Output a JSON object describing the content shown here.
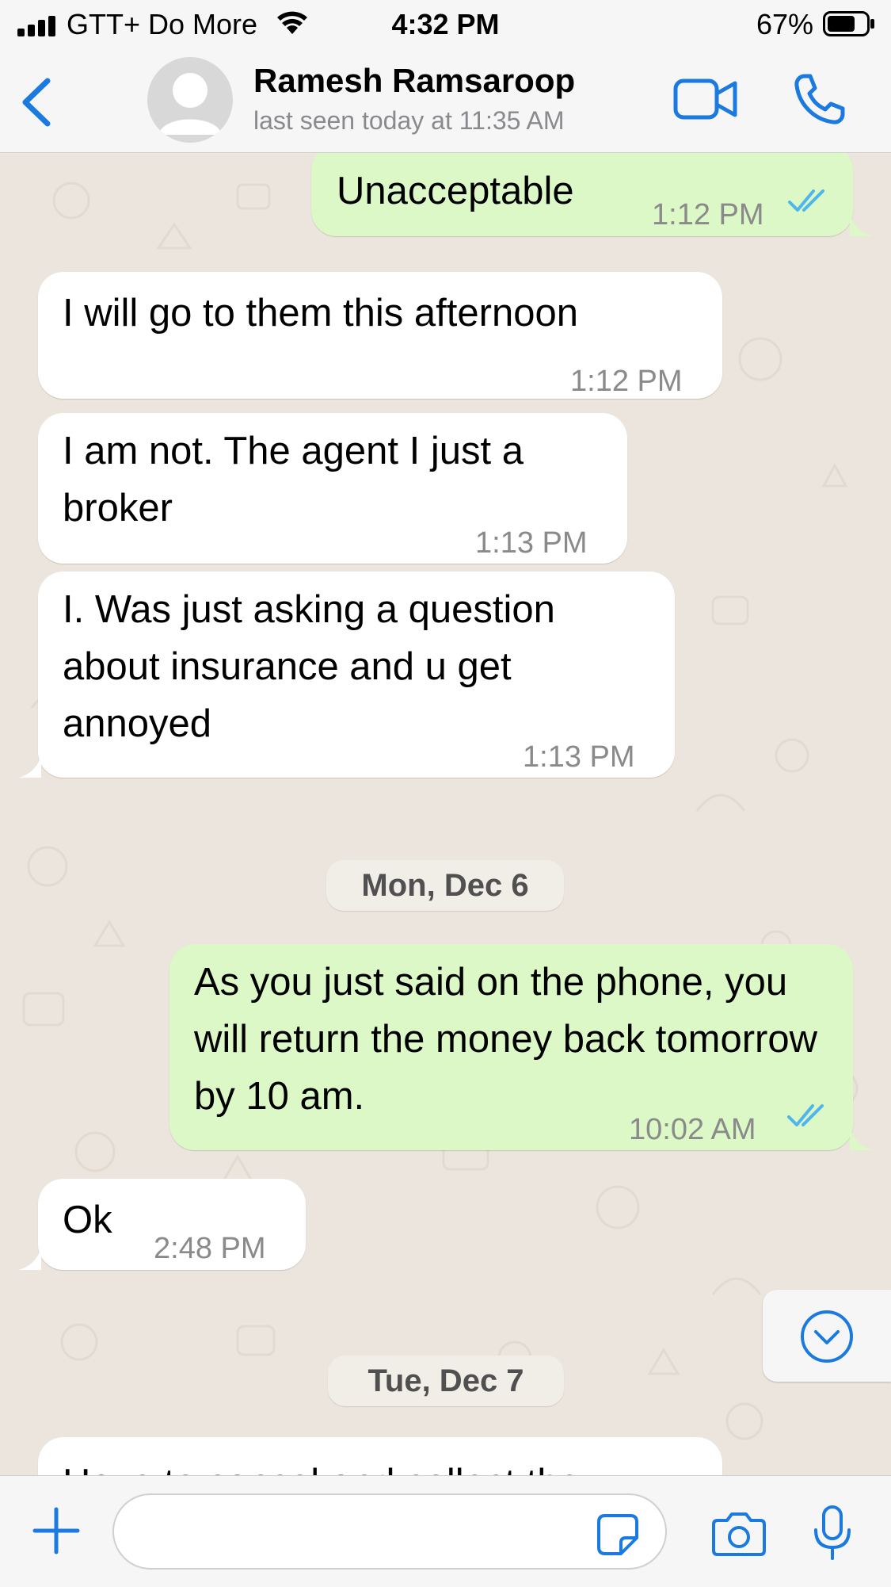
{
  "status_bar": {
    "carrier": "GTT+ Do More",
    "time": "4:32 PM",
    "battery_percent": "67%",
    "icons": [
      "signal-icon",
      "wifi-icon",
      "battery-icon"
    ]
  },
  "header": {
    "contact_name": "Ramesh Ramsaroop",
    "last_seen": "last seen today at 11:35 AM",
    "icons": [
      "back-icon",
      "avatar",
      "video-call-icon",
      "voice-call-icon"
    ]
  },
  "messages": [
    {
      "direction": "outgoing",
      "text": "Unacceptable",
      "time": "1:12 PM",
      "status": "read"
    },
    {
      "direction": "incoming",
      "text": "I will go to them this afternoon",
      "time": "1:12 PM"
    },
    {
      "direction": "incoming",
      "text": "I am not. The agent I just a broker",
      "time": "1:13 PM"
    },
    {
      "direction": "incoming",
      "text": "I. Was just asking a question about insurance and u get annoyed",
      "time": "1:13 PM"
    },
    {
      "direction": "outgoing",
      "text": "As you just said on the phone, you will return the money back tomorrow by 10 am.",
      "time": "10:02 AM",
      "status": "read"
    },
    {
      "direction": "incoming",
      "text": "Ok",
      "time": "2:48 PM"
    },
    {
      "direction": "incoming",
      "text": "Have to cancel and collect the",
      "time": "",
      "partially_visible": true
    }
  ],
  "date_separators": [
    "Mon, Dec 6",
    "Tue, Dec 7"
  ],
  "input_bar": {
    "placeholder": "",
    "icons": [
      "plus-icon",
      "sticker-icon",
      "camera-icon",
      "microphone-icon"
    ]
  },
  "colors": {
    "accent": "#1b7ae0",
    "outgoing_bubble": "#dcf8c6",
    "incoming_bubble": "#ffffff",
    "chat_background": "#ece5dd",
    "read_ticks": "#4fb6ec"
  }
}
